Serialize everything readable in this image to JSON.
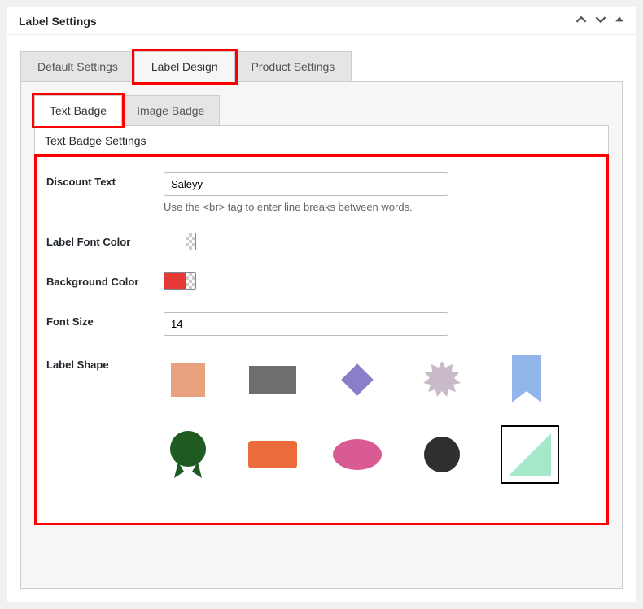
{
  "panel": {
    "title": "Label Settings"
  },
  "main_tabs": {
    "default": "Default Settings",
    "design": "Label Design",
    "product": "Product Settings"
  },
  "sub_tabs": {
    "text": "Text Badge",
    "image": "Image Badge"
  },
  "section": {
    "title": "Text Badge Settings"
  },
  "fields": {
    "discount_label": "Discount Text",
    "discount_value": "Saleyy",
    "discount_hint": "Use the <br> tag to enter line breaks between words.",
    "font_color_label": "Label Font Color",
    "font_color_value": "#ffffff",
    "bg_color_label": "Background Color",
    "bg_color_value": "#e53935",
    "font_size_label": "Font Size",
    "font_size_value": "14",
    "shape_label": "Label Shape"
  },
  "colors": {
    "font_swatch": "#ffffff",
    "bg_swatch": "#e53935"
  },
  "shapes": [
    {
      "name": "square",
      "color": "#e7a17d"
    },
    {
      "name": "rectangle",
      "color": "#6f6f6f"
    },
    {
      "name": "diamond",
      "color": "#8a7ec8"
    },
    {
      "name": "starburst",
      "color": "#c9bac7"
    },
    {
      "name": "ribbon",
      "color": "#92b5ea"
    },
    {
      "name": "seal",
      "color": "#1f5b20"
    },
    {
      "name": "roundrect",
      "color": "#ec6b3b"
    },
    {
      "name": "ellipse",
      "color": "#d95b94"
    },
    {
      "name": "circle",
      "color": "#2f2f2f"
    },
    {
      "name": "triangle",
      "color": "#a4e8c9",
      "selected": true
    }
  ]
}
